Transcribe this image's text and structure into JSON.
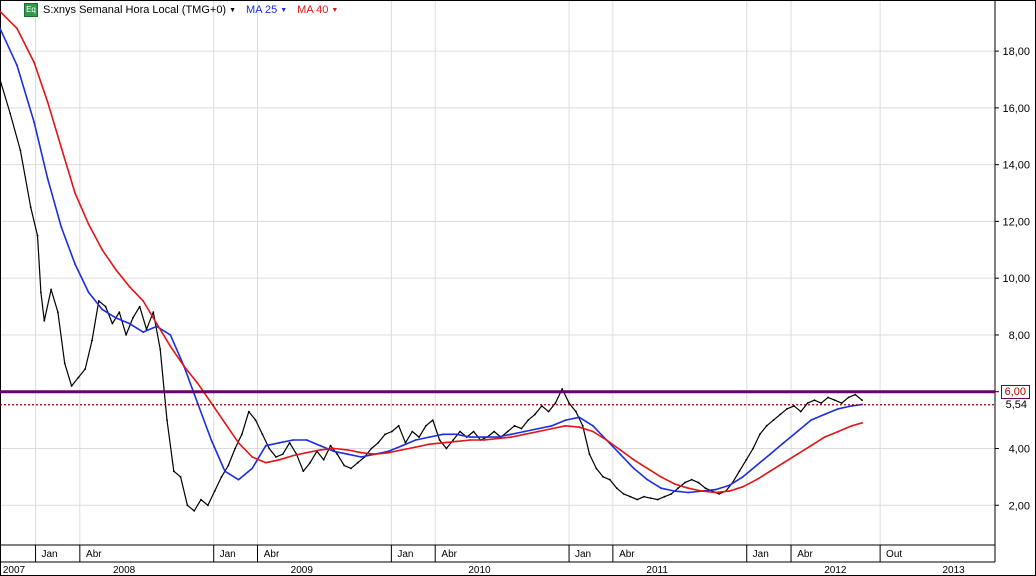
{
  "header": {
    "symbol_badge": "Eq",
    "symbol_label": "S:xnys Semanal Hora Local (TMG+0)",
    "ma25_label": "MA 25",
    "ma40_label": "MA 40"
  },
  "colors": {
    "price": "#000000",
    "ma25": "#1a2ee0",
    "ma40": "#e01515",
    "resistance": "#6a006a",
    "support_dotted": "#8b0000",
    "label_6": "#c00000",
    "grid": "#dcdcdc"
  },
  "price_labels": {
    "resistance": "6,00",
    "support": "5,54"
  },
  "chart_data": {
    "type": "line",
    "title": "",
    "xlabel": "",
    "ylabel": "",
    "y_ticks": [
      "2,00",
      "4,00",
      "6,00",
      "8,00",
      "10,00",
      "12,00",
      "14,00",
      "16,00",
      "18,00"
    ],
    "ylim": [
      0.6,
      19.8
    ],
    "x_range": [
      "2007-10-20",
      "2013-05-25"
    ],
    "month_ticks": [
      {
        "label": "Jan",
        "date": "2008-01-01"
      },
      {
        "label": "Abr",
        "date": "2008-04-01"
      },
      {
        "label": "Jan",
        "date": "2009-01-01"
      },
      {
        "label": "Abr",
        "date": "2009-04-01"
      },
      {
        "label": "Jan",
        "date": "2010-01-01"
      },
      {
        "label": "Abr",
        "date": "2010-04-01"
      },
      {
        "label": "Jan",
        "date": "2011-01-01"
      },
      {
        "label": "Abr",
        "date": "2011-04-01"
      },
      {
        "label": "Jan",
        "date": "2012-01-01"
      },
      {
        "label": "Abr",
        "date": "2012-04-01"
      },
      {
        "label": "Out",
        "date": "2012-10-01"
      }
    ],
    "year_ticks": [
      {
        "label": "2007",
        "date": "2007-10-01"
      },
      {
        "label": "2008",
        "date": "2008-07-01"
      },
      {
        "label": "2009",
        "date": "2009-07-01"
      },
      {
        "label": "2010",
        "date": "2010-07-01"
      },
      {
        "label": "2011",
        "date": "2011-07-01"
      },
      {
        "label": "2012",
        "date": "2012-07-01"
      },
      {
        "label": "2013",
        "date": "2013-03-01"
      }
    ],
    "hlines": [
      6.0,
      5.54
    ],
    "series": [
      {
        "name": "S:xnys",
        "style": "price",
        "points": [
          [
            "2007-10-20",
            17.0
          ],
          [
            "2007-11-10",
            15.8
          ],
          [
            "2007-12-01",
            14.5
          ],
          [
            "2007-12-22",
            12.5
          ],
          [
            "2008-01-05",
            11.5
          ],
          [
            "2008-01-12",
            9.5
          ],
          [
            "2008-01-19",
            8.5
          ],
          [
            "2008-02-02",
            9.6
          ],
          [
            "2008-02-16",
            8.8
          ],
          [
            "2008-03-01",
            7.0
          ],
          [
            "2008-03-15",
            6.2
          ],
          [
            "2008-03-29",
            6.5
          ],
          [
            "2008-04-12",
            6.8
          ],
          [
            "2008-04-26",
            7.8
          ],
          [
            "2008-05-10",
            9.2
          ],
          [
            "2008-05-24",
            9.0
          ],
          [
            "2008-06-07",
            8.4
          ],
          [
            "2008-06-21",
            8.8
          ],
          [
            "2008-07-05",
            8.0
          ],
          [
            "2008-07-19",
            8.6
          ],
          [
            "2008-08-02",
            9.0
          ],
          [
            "2008-08-16",
            8.2
          ],
          [
            "2008-08-30",
            8.8
          ],
          [
            "2008-09-13",
            7.5
          ],
          [
            "2008-09-27",
            5.0
          ],
          [
            "2008-10-11",
            3.2
          ],
          [
            "2008-10-25",
            3.0
          ],
          [
            "2008-11-08",
            2.0
          ],
          [
            "2008-11-22",
            1.8
          ],
          [
            "2008-12-06",
            2.2
          ],
          [
            "2008-12-20",
            2.0
          ],
          [
            "2009-01-03",
            2.5
          ],
          [
            "2009-01-17",
            3.0
          ],
          [
            "2009-01-31",
            3.4
          ],
          [
            "2009-02-14",
            4.0
          ],
          [
            "2009-02-28",
            4.5
          ],
          [
            "2009-03-14",
            5.3
          ],
          [
            "2009-03-28",
            5.0
          ],
          [
            "2009-04-11",
            4.5
          ],
          [
            "2009-04-25",
            4.0
          ],
          [
            "2009-05-09",
            3.7
          ],
          [
            "2009-05-23",
            3.8
          ],
          [
            "2009-06-06",
            4.2
          ],
          [
            "2009-06-20",
            3.8
          ],
          [
            "2009-07-04",
            3.2
          ],
          [
            "2009-07-18",
            3.5
          ],
          [
            "2009-08-01",
            3.9
          ],
          [
            "2009-08-15",
            3.6
          ],
          [
            "2009-08-29",
            4.1
          ],
          [
            "2009-09-12",
            3.8
          ],
          [
            "2009-09-26",
            3.4
          ],
          [
            "2009-10-10",
            3.3
          ],
          [
            "2009-10-24",
            3.5
          ],
          [
            "2009-11-07",
            3.7
          ],
          [
            "2009-11-21",
            4.0
          ],
          [
            "2009-12-05",
            4.2
          ],
          [
            "2009-12-19",
            4.5
          ],
          [
            "2010-01-02",
            4.6
          ],
          [
            "2010-01-16",
            4.8
          ],
          [
            "2010-01-30",
            4.2
          ],
          [
            "2010-02-13",
            4.6
          ],
          [
            "2010-02-27",
            4.4
          ],
          [
            "2010-03-13",
            4.8
          ],
          [
            "2010-03-27",
            5.0
          ],
          [
            "2010-04-10",
            4.3
          ],
          [
            "2010-04-24",
            4.0
          ],
          [
            "2010-05-08",
            4.3
          ],
          [
            "2010-05-22",
            4.6
          ],
          [
            "2010-06-05",
            4.4
          ],
          [
            "2010-06-19",
            4.6
          ],
          [
            "2010-07-03",
            4.3
          ],
          [
            "2010-07-17",
            4.4
          ],
          [
            "2010-07-31",
            4.6
          ],
          [
            "2010-08-14",
            4.4
          ],
          [
            "2010-08-28",
            4.6
          ],
          [
            "2010-09-11",
            4.8
          ],
          [
            "2010-09-25",
            4.7
          ],
          [
            "2010-10-09",
            5.0
          ],
          [
            "2010-10-23",
            5.2
          ],
          [
            "2010-11-06",
            5.5
          ],
          [
            "2010-11-20",
            5.3
          ],
          [
            "2010-12-04",
            5.6
          ],
          [
            "2010-12-18",
            6.1
          ],
          [
            "2011-01-01",
            5.6
          ],
          [
            "2011-01-15",
            5.3
          ],
          [
            "2011-01-29",
            4.8
          ],
          [
            "2011-02-12",
            3.8
          ],
          [
            "2011-02-26",
            3.3
          ],
          [
            "2011-03-12",
            3.0
          ],
          [
            "2011-03-26",
            2.9
          ],
          [
            "2011-04-09",
            2.6
          ],
          [
            "2011-04-23",
            2.4
          ],
          [
            "2011-05-07",
            2.3
          ],
          [
            "2011-05-21",
            2.2
          ],
          [
            "2011-06-04",
            2.3
          ],
          [
            "2011-06-18",
            2.25
          ],
          [
            "2011-07-02",
            2.2
          ],
          [
            "2011-07-16",
            2.3
          ],
          [
            "2011-07-30",
            2.4
          ],
          [
            "2011-08-13",
            2.6
          ],
          [
            "2011-08-27",
            2.8
          ],
          [
            "2011-09-10",
            2.9
          ],
          [
            "2011-09-24",
            2.8
          ],
          [
            "2011-10-08",
            2.6
          ],
          [
            "2011-10-22",
            2.5
          ],
          [
            "2011-11-05",
            2.4
          ],
          [
            "2011-11-19",
            2.5
          ],
          [
            "2011-12-03",
            2.8
          ],
          [
            "2011-12-17",
            3.2
          ],
          [
            "2011-12-31",
            3.6
          ],
          [
            "2012-01-14",
            4.0
          ],
          [
            "2012-01-28",
            4.5
          ],
          [
            "2012-02-11",
            4.8
          ],
          [
            "2012-02-25",
            5.0
          ],
          [
            "2012-03-10",
            5.2
          ],
          [
            "2012-03-24",
            5.4
          ],
          [
            "2012-04-07",
            5.5
          ],
          [
            "2012-04-21",
            5.3
          ],
          [
            "2012-05-05",
            5.6
          ],
          [
            "2012-05-19",
            5.7
          ],
          [
            "2012-06-02",
            5.6
          ],
          [
            "2012-06-16",
            5.8
          ],
          [
            "2012-06-30",
            5.7
          ],
          [
            "2012-07-14",
            5.6
          ],
          [
            "2012-07-28",
            5.8
          ],
          [
            "2012-08-11",
            5.9
          ],
          [
            "2012-08-25",
            5.7
          ]
        ]
      },
      {
        "name": "MA 25",
        "style": "ma25",
        "points": [
          [
            "2007-10-20",
            18.8
          ],
          [
            "2007-11-24",
            17.5
          ],
          [
            "2007-12-29",
            15.5
          ],
          [
            "2008-01-26",
            13.5
          ],
          [
            "2008-02-23",
            11.8
          ],
          [
            "2008-03-22",
            10.5
          ],
          [
            "2008-04-19",
            9.5
          ],
          [
            "2008-05-17",
            8.9
          ],
          [
            "2008-06-14",
            8.6
          ],
          [
            "2008-07-12",
            8.4
          ],
          [
            "2008-08-09",
            8.1
          ],
          [
            "2008-09-06",
            8.3
          ],
          [
            "2008-10-04",
            8.0
          ],
          [
            "2008-11-01",
            6.9
          ],
          [
            "2008-11-29",
            5.6
          ],
          [
            "2008-12-27",
            4.3
          ],
          [
            "2009-01-24",
            3.2
          ],
          [
            "2009-02-21",
            2.9
          ],
          [
            "2009-03-21",
            3.3
          ],
          [
            "2009-04-18",
            4.1
          ],
          [
            "2009-05-16",
            4.2
          ],
          [
            "2009-06-13",
            4.3
          ],
          [
            "2009-07-11",
            4.3
          ],
          [
            "2009-08-08",
            4.1
          ],
          [
            "2009-09-05",
            3.9
          ],
          [
            "2009-10-03",
            3.8
          ],
          [
            "2009-10-31",
            3.7
          ],
          [
            "2009-11-28",
            3.8
          ],
          [
            "2009-12-26",
            3.9
          ],
          [
            "2010-01-23",
            4.1
          ],
          [
            "2010-02-20",
            4.3
          ],
          [
            "2010-03-20",
            4.4
          ],
          [
            "2010-04-17",
            4.5
          ],
          [
            "2010-05-15",
            4.5
          ],
          [
            "2010-06-12",
            4.4
          ],
          [
            "2010-07-10",
            4.4
          ],
          [
            "2010-08-07",
            4.4
          ],
          [
            "2010-09-04",
            4.5
          ],
          [
            "2010-10-02",
            4.6
          ],
          [
            "2010-10-30",
            4.7
          ],
          [
            "2010-11-27",
            4.8
          ],
          [
            "2010-12-25",
            5.0
          ],
          [
            "2011-01-22",
            5.1
          ],
          [
            "2011-02-19",
            4.8
          ],
          [
            "2011-03-19",
            4.3
          ],
          [
            "2011-04-16",
            3.8
          ],
          [
            "2011-05-14",
            3.3
          ],
          [
            "2011-06-11",
            2.9
          ],
          [
            "2011-07-09",
            2.6
          ],
          [
            "2011-08-06",
            2.5
          ],
          [
            "2011-09-03",
            2.45
          ],
          [
            "2011-10-01",
            2.5
          ],
          [
            "2011-10-29",
            2.55
          ],
          [
            "2011-11-26",
            2.7
          ],
          [
            "2011-12-24",
            3.0
          ],
          [
            "2012-01-21",
            3.4
          ],
          [
            "2012-02-18",
            3.8
          ],
          [
            "2012-03-17",
            4.2
          ],
          [
            "2012-04-14",
            4.6
          ],
          [
            "2012-05-12",
            5.0
          ],
          [
            "2012-06-09",
            5.2
          ],
          [
            "2012-07-07",
            5.4
          ],
          [
            "2012-08-04",
            5.5
          ],
          [
            "2012-08-25",
            5.55
          ]
        ]
      },
      {
        "name": "MA 40",
        "style": "ma40",
        "points": [
          [
            "2007-10-20",
            19.4
          ],
          [
            "2007-11-24",
            18.8
          ],
          [
            "2007-12-29",
            17.6
          ],
          [
            "2008-01-26",
            16.2
          ],
          [
            "2008-02-23",
            14.6
          ],
          [
            "2008-03-22",
            13.0
          ],
          [
            "2008-04-19",
            11.9
          ],
          [
            "2008-05-17",
            11.0
          ],
          [
            "2008-06-14",
            10.3
          ],
          [
            "2008-07-12",
            9.7
          ],
          [
            "2008-08-09",
            9.2
          ],
          [
            "2008-09-06",
            8.4
          ],
          [
            "2008-10-04",
            7.6
          ],
          [
            "2008-11-01",
            6.9
          ],
          [
            "2008-11-29",
            6.3
          ],
          [
            "2008-12-27",
            5.6
          ],
          [
            "2009-01-24",
            4.9
          ],
          [
            "2009-02-21",
            4.2
          ],
          [
            "2009-03-21",
            3.7
          ],
          [
            "2009-04-18",
            3.5
          ],
          [
            "2009-05-16",
            3.6
          ],
          [
            "2009-06-13",
            3.75
          ],
          [
            "2009-07-11",
            3.85
          ],
          [
            "2009-08-08",
            3.95
          ],
          [
            "2009-09-05",
            4.0
          ],
          [
            "2009-10-03",
            3.95
          ],
          [
            "2009-10-31",
            3.85
          ],
          [
            "2009-11-28",
            3.8
          ],
          [
            "2009-12-26",
            3.85
          ],
          [
            "2010-01-23",
            3.95
          ],
          [
            "2010-02-20",
            4.05
          ],
          [
            "2010-03-20",
            4.15
          ],
          [
            "2010-04-17",
            4.2
          ],
          [
            "2010-05-15",
            4.25
          ],
          [
            "2010-06-12",
            4.3
          ],
          [
            "2010-07-10",
            4.3
          ],
          [
            "2010-08-07",
            4.35
          ],
          [
            "2010-09-04",
            4.4
          ],
          [
            "2010-10-02",
            4.5
          ],
          [
            "2010-10-30",
            4.6
          ],
          [
            "2010-11-27",
            4.7
          ],
          [
            "2010-12-25",
            4.8
          ],
          [
            "2011-01-22",
            4.75
          ],
          [
            "2011-02-19",
            4.6
          ],
          [
            "2011-03-19",
            4.3
          ],
          [
            "2011-04-16",
            3.95
          ],
          [
            "2011-05-14",
            3.6
          ],
          [
            "2011-06-11",
            3.3
          ],
          [
            "2011-07-09",
            3.0
          ],
          [
            "2011-08-06",
            2.75
          ],
          [
            "2011-09-03",
            2.6
          ],
          [
            "2011-10-01",
            2.5
          ],
          [
            "2011-10-29",
            2.45
          ],
          [
            "2011-11-26",
            2.5
          ],
          [
            "2011-12-24",
            2.65
          ],
          [
            "2012-01-21",
            2.9
          ],
          [
            "2012-02-18",
            3.2
          ],
          [
            "2012-03-17",
            3.5
          ],
          [
            "2012-04-14",
            3.8
          ],
          [
            "2012-05-12",
            4.1
          ],
          [
            "2012-06-09",
            4.4
          ],
          [
            "2012-07-07",
            4.6
          ],
          [
            "2012-08-04",
            4.8
          ],
          [
            "2012-08-25",
            4.9
          ]
        ]
      }
    ]
  }
}
